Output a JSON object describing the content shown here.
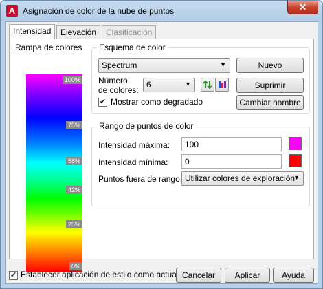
{
  "window": {
    "title": "Asignación de color de la nube de puntos",
    "app_icon_letter": "A",
    "close_glyph": "✕"
  },
  "tabs": [
    {
      "label": "Intensidad",
      "active": true
    },
    {
      "label": "Elevación",
      "active": false
    },
    {
      "label": "Clasificación",
      "disabled": true
    }
  ],
  "ramp": {
    "label": "Rampa de colores",
    "ticks": [
      "100%",
      "75%",
      "58%",
      "42%",
      "25%",
      "0%"
    ]
  },
  "scheme": {
    "label": "Esquema de color",
    "selected": "Spectrum",
    "num_colors_label_1": "Número",
    "num_colors_label_2": "de colores:",
    "num_colors_value": "6",
    "gradient_label": "Mostrar como degradado",
    "gradient_checked": true,
    "new_button": "Nuevo",
    "delete_button": "Suprimir",
    "rename_button": "Cambiar nombre"
  },
  "range": {
    "label": "Rango de puntos de color",
    "max_label": "Intensidad máxima:",
    "max_value": "100",
    "max_color": "#ff00ff",
    "min_label": "Intensidad mínima:",
    "min_value": "0",
    "min_color": "#ff0000",
    "out_label": "Puntos fuera de rango:",
    "out_value": "Utilizar colores de exploración"
  },
  "footer": {
    "apply_style_label": "Establecer aplicación de estilo como actual",
    "apply_style_checked": true,
    "cancel": "Cancelar",
    "apply": "Aplicar",
    "help": "Ayuda"
  }
}
